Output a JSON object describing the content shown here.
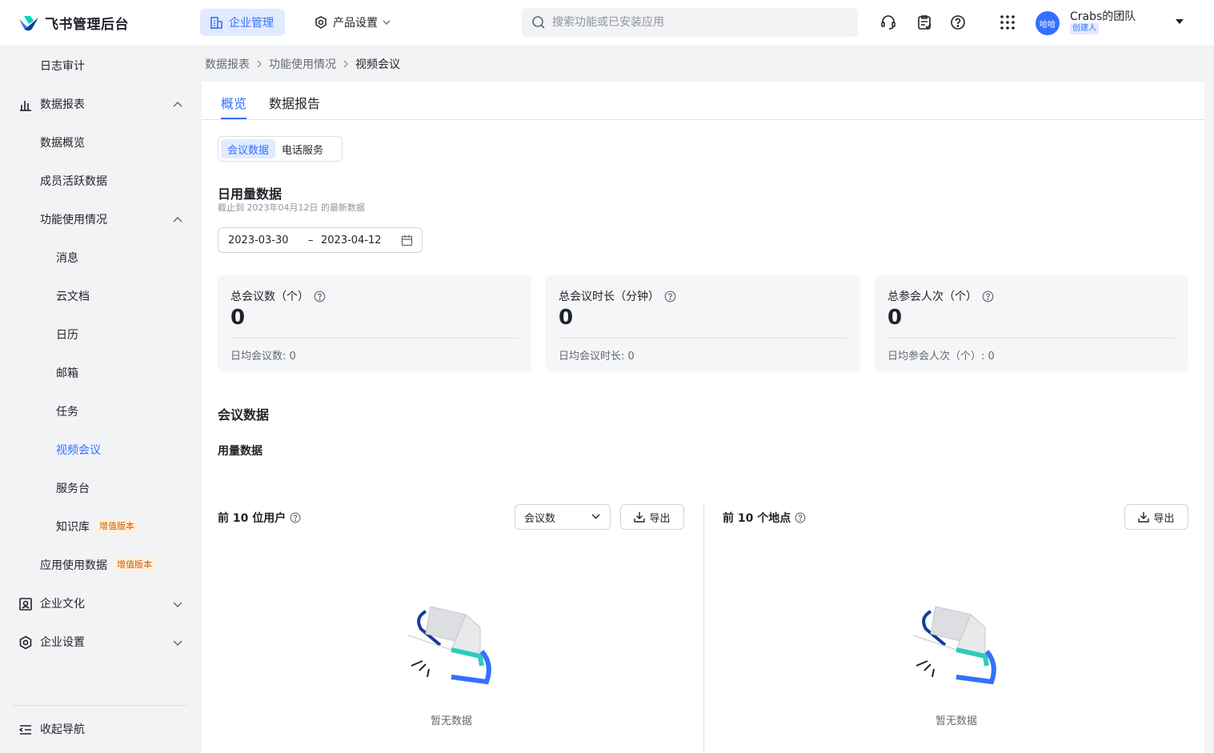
{
  "app": {
    "title": "飞书管理后台"
  },
  "topnav": {
    "enterprise": "企业管理",
    "product": "产品设置",
    "search_placeholder": "搜索功能或已安装应用"
  },
  "user": {
    "avatar_text": "哈哈",
    "team": "Crabs的团队",
    "role": "创建人"
  },
  "sidebar": {
    "items": [
      {
        "label": "日志审计"
      },
      {
        "label": "数据报表"
      },
      {
        "label": "数据概览"
      },
      {
        "label": "成员活跃数据"
      },
      {
        "label": "功能使用情况"
      },
      {
        "label": "消息"
      },
      {
        "label": "云文档"
      },
      {
        "label": "日历"
      },
      {
        "label": "邮箱"
      },
      {
        "label": "任务"
      },
      {
        "label": "视频会议"
      },
      {
        "label": "服务台"
      },
      {
        "label": "知识库",
        "badge": "增值版本"
      },
      {
        "label": "应用使用数据",
        "badge": "增值版本"
      },
      {
        "label": "企业文化"
      },
      {
        "label": "企业设置"
      }
    ],
    "collapse": "收起导航"
  },
  "breadcrumb": [
    "数据报表",
    "功能使用情况",
    "视频会议"
  ],
  "tabs": [
    "概览",
    "数据报告"
  ],
  "segment": [
    "会议数据",
    "电话服务"
  ],
  "daily": {
    "title": "日用量数据",
    "subtitle": "截止到 2023年04月12日 的最新数据",
    "start": "2023-03-30",
    "dash": "–",
    "end": "2023-04-12"
  },
  "cards": [
    {
      "label": "总会议数（个）",
      "value": "0",
      "sub": "日均会议数: 0"
    },
    {
      "label": "总会议时长（分钟）",
      "value": "0",
      "sub": "日均会议时长: 0"
    },
    {
      "label": "总参会人次（个）",
      "value": "0",
      "sub": "日均参会人次（个）: 0"
    }
  ],
  "meeting": {
    "title": "会议数据",
    "usage": "用量数据"
  },
  "top_users": {
    "title": "前 10 位用户",
    "select": "会议数",
    "export": "导出",
    "empty": "暂无数据"
  },
  "top_locations": {
    "title": "前 10 个地点",
    "export": "导出",
    "empty": "暂无数据"
  },
  "colors": {
    "accent": "#3370ff",
    "badge": "#d25f00",
    "teal": "#2dcbb9"
  }
}
